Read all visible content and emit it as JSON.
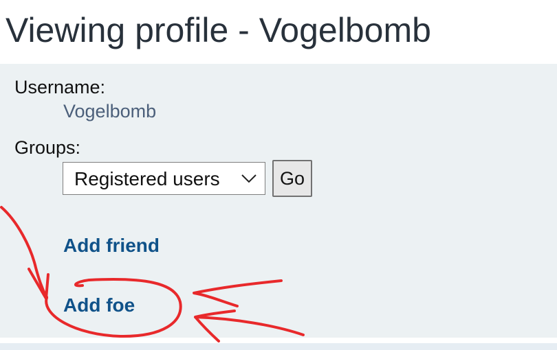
{
  "page": {
    "title": "Viewing profile - Vogelbomb"
  },
  "profile": {
    "username_label": "Username:",
    "username_value": "Vogelbomb",
    "groups_label": "Groups:",
    "groups_selected": "Registered users",
    "go_label": "Go",
    "add_friend_label": "Add friend",
    "add_foe_label": "Add foe"
  },
  "colors": {
    "title_text": "#28313b",
    "panel_bg": "#ecf1f3",
    "link": "#105289",
    "username_value": "#4b5f7a",
    "annotation_red": "#e8292b"
  },
  "icons": {
    "select_arrow": "chevron-down-icon"
  }
}
